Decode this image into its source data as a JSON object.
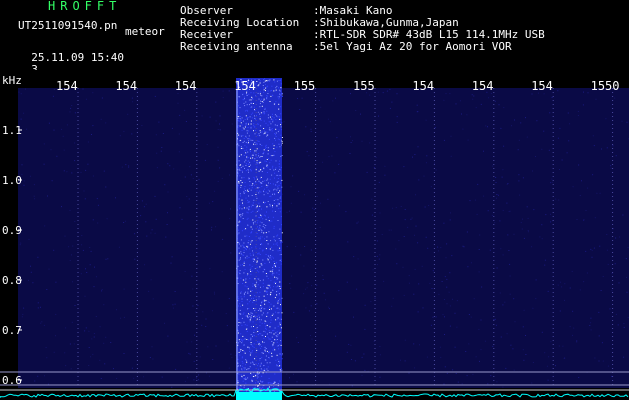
{
  "header": {
    "brand": "HROFFT",
    "filename": "UT2511091540.pn",
    "timestamp": "25.11.09 15:40",
    "timestamp_suffix": "3_",
    "tag": "meteor",
    "fields": [
      {
        "label": "Observer",
        "value": ":Masaki Kano"
      },
      {
        "label": "Receiving Location",
        "value": ":Shibukawa,Gunma,Japan"
      },
      {
        "label": "Receiver",
        "value": ":RTL-SDR SDR# 43dB L15 114.1MHz USB"
      },
      {
        "label": "Receiving antenna",
        "value": ":5el Yagi Az 20 for Aomori VOR"
      }
    ]
  },
  "chart_data": {
    "type": "heatmap",
    "ylabel": "kHz",
    "y_ticks": [
      "1.1",
      "1.0",
      "0.9",
      "0.8",
      "0.7",
      "0.6"
    ],
    "x_ticks": [
      "154",
      "154",
      "154",
      "154",
      "155",
      "155",
      "154",
      "154",
      "154",
      "1550"
    ],
    "grid": true
  },
  "colors": {
    "brand": "#33ff66",
    "header_text": "#ffffff",
    "background_noise": "#0a0a46",
    "meteor_band": "#3344ff",
    "axis": "#ffffff",
    "cyan": "#00ffff"
  }
}
